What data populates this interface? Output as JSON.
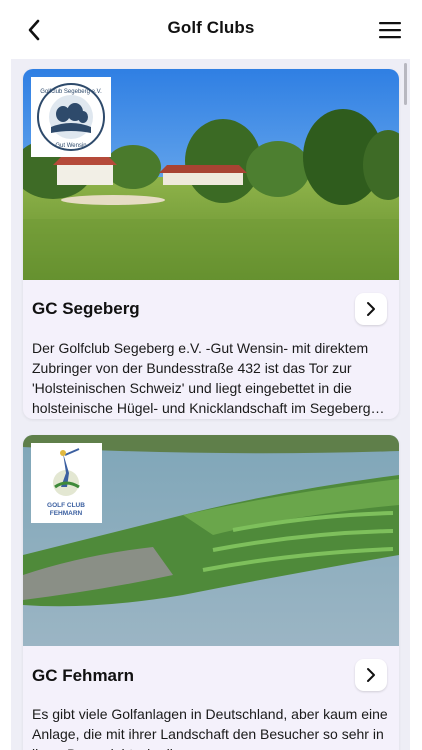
{
  "nav": {
    "title": "Golf Clubs",
    "back_icon": "chevron-left-icon",
    "menu_icon": "hamburger-menu-icon"
  },
  "clubs": [
    {
      "name": "GC Segeberg",
      "logo_text_top": "Golfclub Segeberg e.V.",
      "logo_text_bottom": "Gut Wensin",
      "description": "Der Golfclub Segeberg e.V. -Gut Wensin- mit direktem Zubringer von der Bundesstraße 432 ist das Tor zur 'Holsteinischen Schweiz' und liegt eingebettet in die holsteinische Hügel- und Knicklandschaft im Segeberger Raum."
    },
    {
      "name": "GC Fehmarn",
      "logo_text": "GOLF CLUB FEHMARN",
      "description": "Es gibt viele Golfanlagen in Deutschland, aber kaum eine Anlage, die mit ihrer Landschaft den Besucher so sehr in ihren Bann zieht wie diese."
    }
  ],
  "colors": {
    "content_bg": "#eeeef6",
    "card_bg": "#f4f1fb"
  }
}
